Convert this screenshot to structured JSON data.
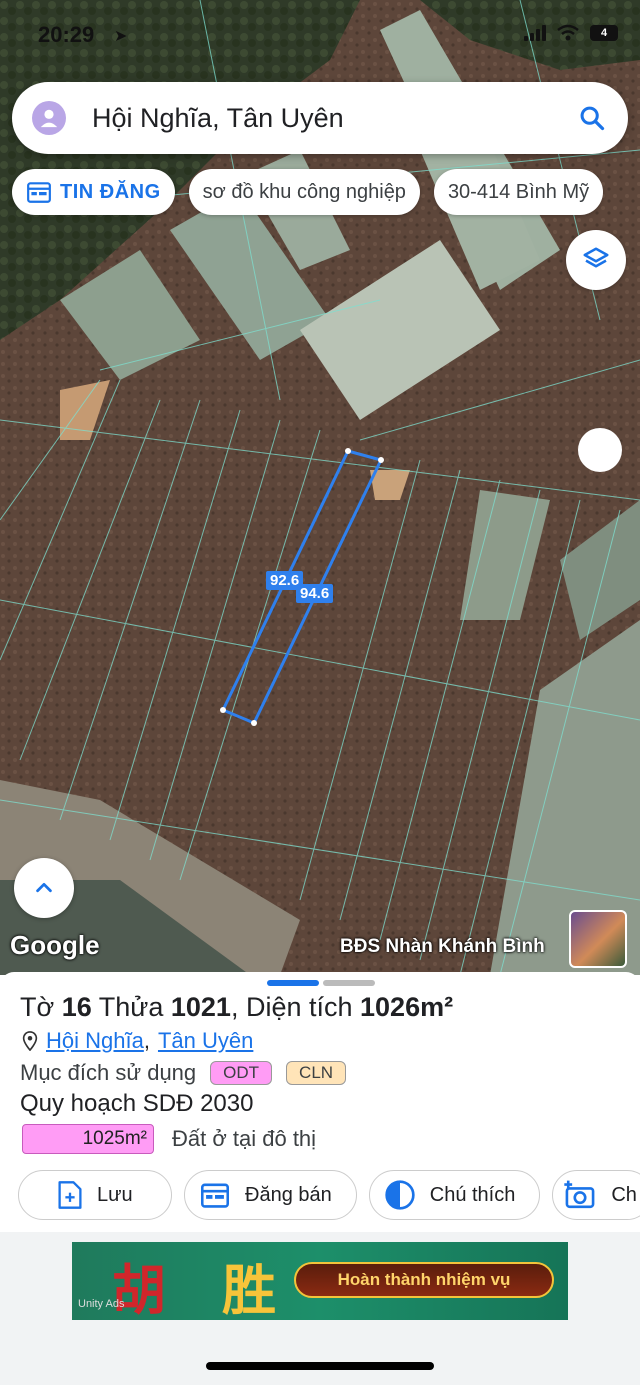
{
  "status_bar": {
    "time": "20:29",
    "battery": "4"
  },
  "search": {
    "query": "Hội Nghĩa, Tân Uyên"
  },
  "chips": [
    {
      "label": "TIN ĐĂNG",
      "icon": "calendar-icon"
    },
    {
      "label": "sơ đồ khu công nghiệp"
    },
    {
      "label": "30-414 Bình Mỹ"
    }
  ],
  "map": {
    "dimension_labels": [
      "92.6",
      "94.6"
    ],
    "google_logo": "Google",
    "watermark": "BĐS Nhàn Khánh Bình"
  },
  "parcel": {
    "title_prefix": "Tờ ",
    "sheet_no": "16",
    "mid1": " Thửa ",
    "parcel_no": "1021",
    "mid2": ", Diện tích ",
    "area": "1026m²",
    "address": {
      "commune": "Hội Nghĩa",
      "sep": ",",
      "district": "Tân Uyên"
    },
    "purpose_label": "Mục đích sử dụng",
    "purpose_tags": [
      "ODT",
      "CLN"
    ],
    "plan_label": "Quy hoạch SDĐ 2030",
    "plan_area": "1025m²",
    "plan_desc": "Đất ở tại đô thị"
  },
  "actions": [
    {
      "label": "Lưu",
      "icon": "add-doc-icon"
    },
    {
      "label": "Đăng bán",
      "icon": "calendar-icon"
    },
    {
      "label": "Chú thích",
      "icon": "half-circle-icon"
    },
    {
      "label": "Ch",
      "icon": "camera-plus-icon"
    }
  ],
  "ad": {
    "text": "Hoàn thành nhiệm vụ",
    "provider": "Unity Ads"
  },
  "colors": {
    "accent": "#1a73e8",
    "odt": "#ff9cf5",
    "cln": "#ffe4b8",
    "parcel_line": "#2f80ed"
  }
}
